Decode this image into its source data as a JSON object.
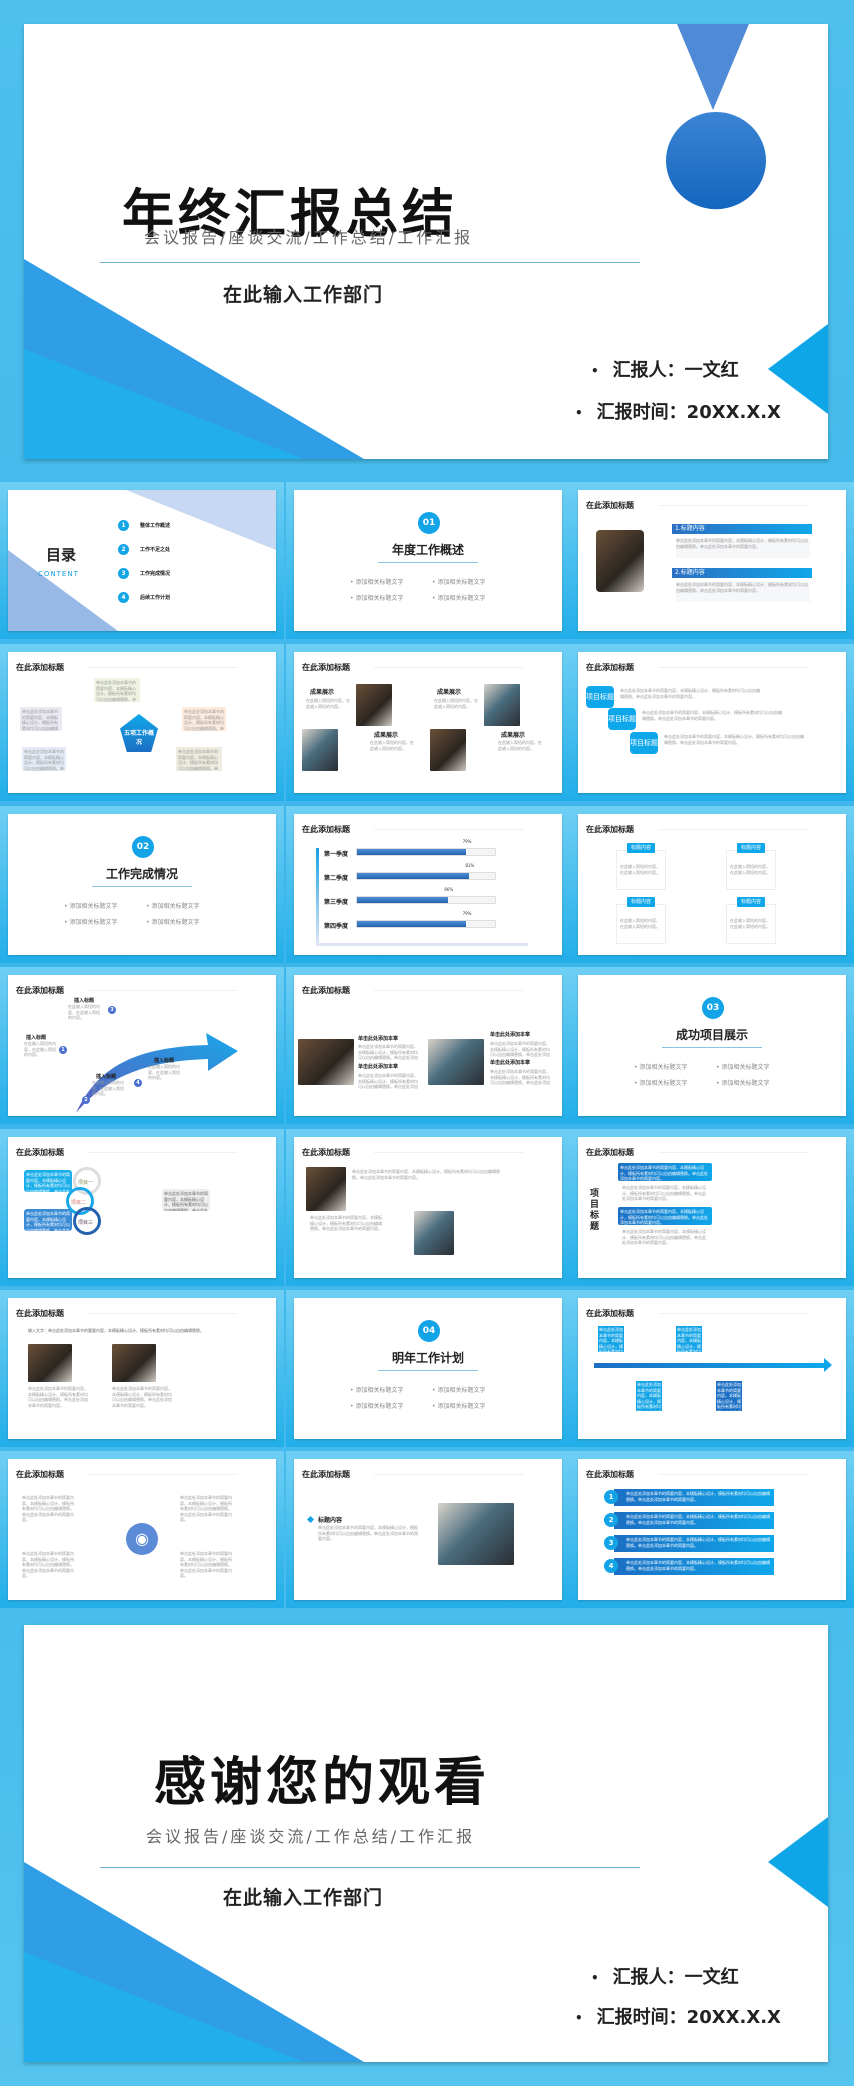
{
  "cover": {
    "title": "年终汇报总结",
    "subtitle": "会议报告/座谈交流/工作总结/工作汇报",
    "department": "在此输入工作部门",
    "reporter": "汇报人：一文红",
    "time": "汇报时间：20XX.X.X",
    "bullet": "•"
  },
  "ending": {
    "title": "感谢您的观看",
    "subtitle": "会议报告/座谈交流/工作总结/工作汇报",
    "department": "在此输入工作部门",
    "reporter": "汇报人：一文红",
    "time": "汇报时间：20XX.X.X",
    "bullet": "•"
  },
  "common": {
    "slide_title": "在此添加标题",
    "body": "单击此处添加本章节的简要内容，本模板精心设计，模板所有素材均可以自由编辑替换。单击此处添加本章节的简要内容。",
    "short": "在此输入简短的内容，在此输入简短的内容。",
    "bullet_text": "• 添加相关标题文字"
  },
  "toc": {
    "title": "目录",
    "subtitle": "CONTENT",
    "items": [
      {
        "n": "1",
        "label": "整体工作概述"
      },
      {
        "n": "2",
        "label": "工作不足之处"
      },
      {
        "n": "3",
        "label": "工作完成情况"
      },
      {
        "n": "4",
        "label": "后续工作计划"
      }
    ]
  },
  "sections": [
    {
      "n": "01",
      "title": "年度工作概述"
    },
    {
      "n": "02",
      "title": "工作完成情况"
    },
    {
      "n": "03",
      "title": "成功项目展示"
    },
    {
      "n": "04",
      "title": "明年工作计划"
    }
  ],
  "s3": {
    "h1": "1.标题内容",
    "h2": "2.标题内容"
  },
  "s4": {
    "center": "五项工作概况"
  },
  "s5": {
    "label": "成果展示"
  },
  "s6": {
    "label": "项目标题"
  },
  "s8": {
    "quarters": [
      {
        "label": "第一季度",
        "value": 79,
        "text": "79%"
      },
      {
        "label": "第二季度",
        "value": 81,
        "text": "81%"
      },
      {
        "label": "第三季度",
        "value": 66,
        "text": "66%"
      },
      {
        "label": "第四季度",
        "value": 79,
        "text": "79%"
      }
    ]
  },
  "s9": {
    "label": "标题内容"
  },
  "s10": {
    "label": "插入标题",
    "nums": [
      "1",
      "2",
      "3",
      "4"
    ]
  },
  "s11": {
    "label": "单击此处添加本章"
  },
  "s13": {
    "items": [
      "项目一",
      "项目二",
      "项目三"
    ]
  },
  "s15": {
    "vertical": "项目标题"
  },
  "s16": {
    "intro": "输入文字：单击此处添加本章节的重要内容，本模板精心设计，模板所有素材均可以自由编辑替换。"
  },
  "s20": {
    "label": "标题内容"
  },
  "s21": {
    "nums": [
      "1",
      "2",
      "3",
      "4"
    ]
  },
  "colors": {
    "accent": "#10a7ea",
    "dark_blue": "#2462b0",
    "background": "#3ab4ea"
  }
}
